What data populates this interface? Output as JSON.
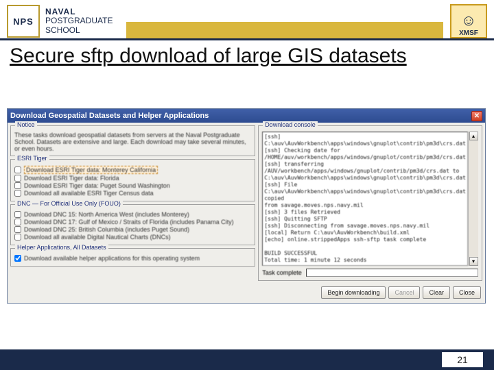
{
  "header": {
    "nps_acronym": "NPS",
    "nps_line1": "NAVAL",
    "nps_line2": "POSTGRADUATE",
    "nps_line3": "SCHOOL",
    "xmsf_label": "XMSF"
  },
  "slide": {
    "title": "Secure sftp download of large GIS datasets",
    "page_number": "21"
  },
  "dialog": {
    "title": "Download Geospatial Datasets and Helper Applications",
    "close_label": "✕",
    "notice": {
      "legend": "Notice",
      "text": "These tasks download geospatial datasets from servers at the Naval Postgraduate School. Datasets are extensive and large. Each download may take several minutes, or even hours."
    },
    "esri": {
      "legend": "ESRI Tiger",
      "items": [
        "Download ESRI Tiger data: Monterey California",
        "Download ESRI Tiger data: Florida",
        "Download ESRI Tiger data: Puget Sound Washington",
        "Download all available ESRI Tiger Census data"
      ]
    },
    "dnc": {
      "legend": "DNC — For Official Use Only (FOUO)",
      "items": [
        "Download DNC 15: North America West (includes Monterey)",
        "Download DNC 17: Gulf of Mexico / Straits of Florida (includes Panama City)",
        "Download DNC 25: British Columbia (includes Puget Sound)",
        "Download all available Digital Nautical Charts (DNCs)"
      ]
    },
    "helper": {
      "legend": "Helper Applications, All Datasets",
      "item": "Download available helper applications for this operating system"
    },
    "console": {
      "legend": "Download console",
      "text": "[ssh]\nC:\\auv\\AuvWorkbench\\apps\\windows\\gnuplot\\contrib\\pm3d\\crs.dat\n[ssh] Checking date for\n/HOME/auv/workbench/apps/windows/gnuplot/contrib/pm3d/crs.dat\n[ssh] transferring\n/AUV/workbench/apps/windows/gnuplot/contrib/pm3d/crs.dat to\nC:\\auv\\AuvWorkbench\\apps\\windows\\gnuplot\\contrib\\pm3d\\crs.dat\n[ssh] File\nC:\\auv\\AuvWorkbench\\apps\\windows\\gnuplot\\contrib\\pm3d\\crs.dat copied\nfrom savage.moves.nps.navy.mil\n[ssh] 3 files Retrieved\n[ssh] Quitting SFTP\n[ssh] Disconnecting from savage.moves.nps.navy.mil\n[local] Return C:\\auv\\AuvWorkbench\\build.xml\n[echo] online.strippedApps ssh-sftp task complete\n\nBUILD SUCCESSFUL\nTotal time: 1 minute 12 seconds"
    },
    "status_label": "Task complete",
    "buttons": {
      "begin": "Begin downloading",
      "cancel": "Cancel",
      "clear": "Clear",
      "close": "Close"
    }
  }
}
